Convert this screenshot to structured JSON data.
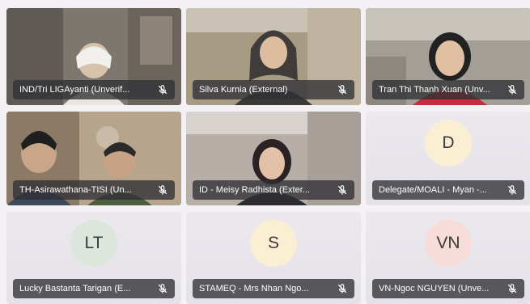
{
  "participants": [
    {
      "name": "IND/Tri LIGAyanti (Unverif...",
      "type": "video",
      "mic_icon": "mic-muted-icon"
    },
    {
      "name": "Silva Kurnia (External)",
      "type": "video",
      "mic_icon": "mic-muted-icon"
    },
    {
      "name": "Tran Thi Thanh Xuan (Unv...",
      "type": "video",
      "mic_icon": "mic-muted-icon"
    },
    {
      "name": "TH-Asirawathana-TISI (Un...",
      "type": "video",
      "mic_icon": "mic-muted-icon"
    },
    {
      "name": "ID - Meisy Radhista (Exter...",
      "type": "video",
      "mic_icon": "mic-muted-icon"
    },
    {
      "name": "Delegate/MOALI - Myan -...",
      "type": "avatar",
      "initials": "D",
      "avatar_color": "#faeed3",
      "mic_icon": "mic-muted-icon"
    },
    {
      "name": "Lucky Bastanta Tarigan (E...",
      "type": "avatar",
      "initials": "LT",
      "avatar_color": "#dde6dc",
      "mic_icon": "mic-muted-icon"
    },
    {
      "name": "STAMEQ - Mrs Nhan Ngo...",
      "type": "avatar",
      "initials": "S",
      "avatar_color": "#faeed3",
      "mic_icon": "mic-muted-icon"
    },
    {
      "name": "VN-Ngoc NGUYEN (Unve...",
      "type": "avatar",
      "initials": "VN",
      "avatar_color": "#f7ddd9",
      "mic_icon": "mic-muted-icon"
    }
  ]
}
